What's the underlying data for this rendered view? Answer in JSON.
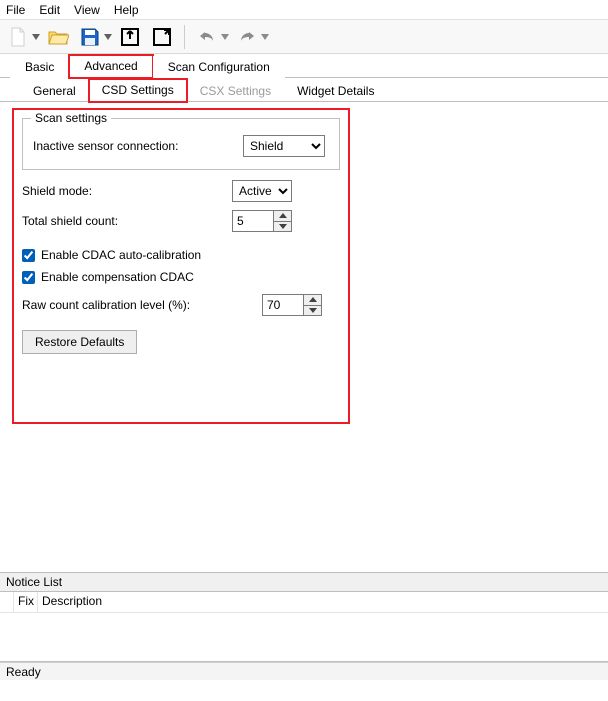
{
  "menu": {
    "file": "File",
    "edit": "Edit",
    "view": "View",
    "help": "Help"
  },
  "tabs_primary": {
    "basic": "Basic",
    "advanced": "Advanced",
    "scan_config": "Scan Configuration"
  },
  "tabs_sub": {
    "general": "General",
    "csd": "CSD Settings",
    "csx": "CSX Settings",
    "widget": "Widget Details"
  },
  "scan_settings": {
    "group_title": "Scan settings",
    "inactive_label": "Inactive sensor connection:",
    "inactive_value": "Shield"
  },
  "fields": {
    "shield_mode_label": "Shield mode:",
    "shield_mode_value": "Active",
    "total_shield_label": "Total shield count:",
    "total_shield_value": "5",
    "cdac_auto_label": "Enable CDAC auto-calibration",
    "cdac_auto_checked": true,
    "comp_cdac_label": "Enable compensation CDAC",
    "comp_cdac_checked": true,
    "raw_count_label": "Raw count calibration level (%):",
    "raw_count_value": "70",
    "restore_defaults": "Restore Defaults"
  },
  "notice": {
    "title": "Notice List",
    "col_fix": "Fix",
    "col_desc": "Description"
  },
  "status": {
    "text": "Ready"
  }
}
